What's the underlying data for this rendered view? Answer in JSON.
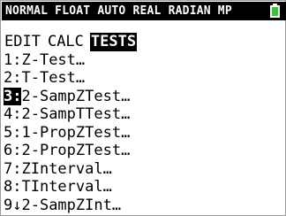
{
  "status_bar": {
    "text": "NORMAL FLOAT AUTO REAL RADIAN MP",
    "battery_icon": "battery-full-icon",
    "battery_color": "#3fbf3f"
  },
  "menu": {
    "tabs": [
      {
        "label": "EDIT",
        "active": false
      },
      {
        "label": "CALC",
        "active": false
      },
      {
        "label": "TESTS",
        "active": true
      }
    ],
    "items": [
      {
        "num": "1:",
        "label": "Z-Test…"
      },
      {
        "num": "2:",
        "label": "T-Test…"
      },
      {
        "num": "3:",
        "label": "2-SampZTest…",
        "selected": true
      },
      {
        "num": "4:",
        "label": "2-SampTTest…"
      },
      {
        "num": "5:",
        "label": "1-PropZTest…"
      },
      {
        "num": "6:",
        "label": "2-PropZTest…"
      },
      {
        "num": "7:",
        "label": "ZInterval…"
      },
      {
        "num": "8:",
        "label": "TInterval…"
      },
      {
        "num": "9↓",
        "label": "2-SampZInt…"
      }
    ]
  }
}
